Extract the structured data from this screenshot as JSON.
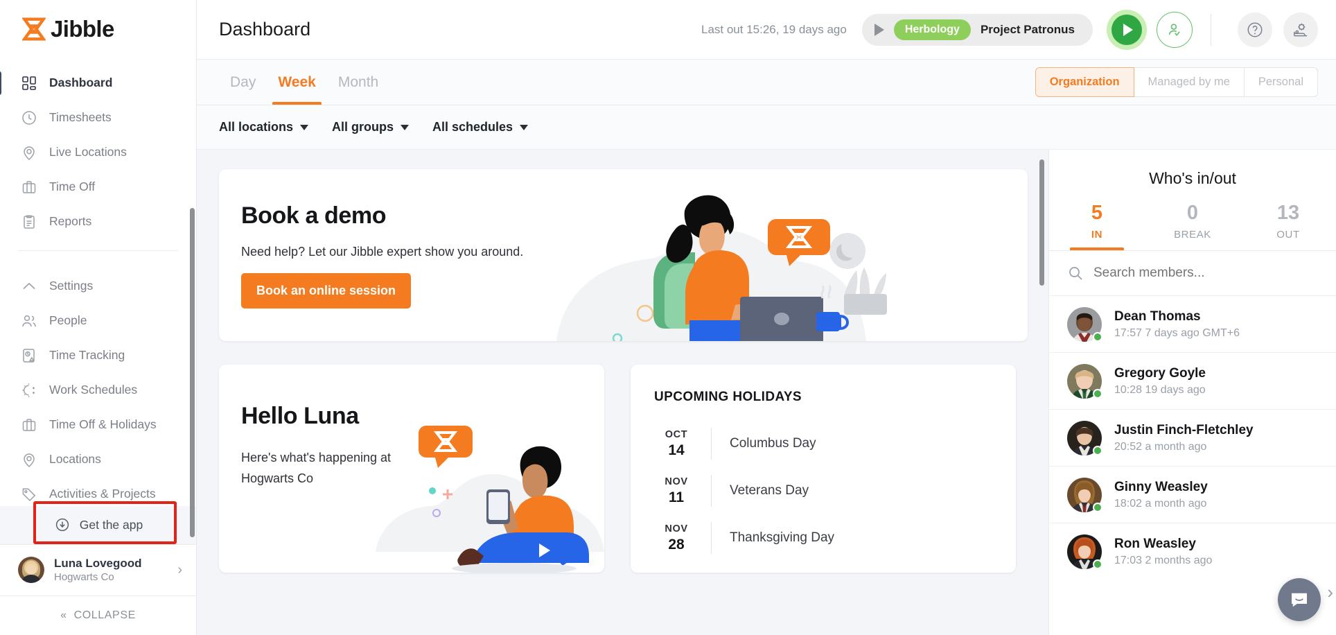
{
  "brand": {
    "name": "Jibble",
    "logo_icon": "hourglass-icon"
  },
  "sidebar": {
    "primary": [
      {
        "label": "Dashboard",
        "icon": "dashboard-grid-icon",
        "active": true
      },
      {
        "label": "Timesheets",
        "icon": "clock-icon",
        "active": false
      },
      {
        "label": "Live Locations",
        "icon": "map-pin-icon",
        "active": false
      },
      {
        "label": "Time Off",
        "icon": "briefcase-icon",
        "active": false
      },
      {
        "label": "Reports",
        "icon": "clipboard-icon",
        "active": false
      }
    ],
    "secondary": [
      {
        "label": "Settings",
        "icon": "chevron-up-icon"
      },
      {
        "label": "People",
        "icon": "people-icon"
      },
      {
        "label": "Time Tracking",
        "icon": "time-tracking-icon"
      },
      {
        "label": "Work Schedules",
        "icon": "sun-moon-icon"
      },
      {
        "label": "Time Off & Holidays",
        "icon": "briefcase-icon"
      },
      {
        "label": "Locations",
        "icon": "map-pin-icon"
      },
      {
        "label": "Activities & Projects",
        "icon": "tag-icon"
      }
    ],
    "get_app": {
      "label": "Get the app",
      "icon": "download-circle-icon"
    },
    "user": {
      "name": "Luna Lovegood",
      "org": "Hogwarts Co",
      "chevron": "chevron-right-icon"
    },
    "collapse": {
      "label": "COLLAPSE",
      "icon": "double-chevron-left-icon"
    }
  },
  "topbar": {
    "title": "Dashboard",
    "last_out": "Last out 15:26, 19 days ago",
    "tracker": {
      "activity": "Herbology",
      "project": "Project Patronus",
      "play_icon": "play-triangle-icon"
    },
    "clock_in_button": "play-button",
    "people_button": "person-check-icon",
    "help_button": "question-mark-icon",
    "settings_button": "gear-bed-icon"
  },
  "tabs": {
    "items": [
      {
        "label": "Day",
        "active": false
      },
      {
        "label": "Week",
        "active": true
      },
      {
        "label": "Month",
        "active": false
      }
    ],
    "scope": [
      {
        "label": "Organization",
        "active": true
      },
      {
        "label": "Managed by me",
        "active": false
      },
      {
        "label": "Personal",
        "active": false
      }
    ]
  },
  "filters": [
    {
      "label": "All locations"
    },
    {
      "label": "All groups"
    },
    {
      "label": "All schedules"
    }
  ],
  "demo_card": {
    "title": "Book a demo",
    "subtitle": "Need help? Let our Jibble expert show you around.",
    "button": "Book an online session",
    "illustration": "woman-at-laptop-illustration"
  },
  "hello_card": {
    "title": "Hello Luna",
    "subtitle": "Here's what's happening at Hogwarts Co",
    "illustration": "person-with-phone-illustration"
  },
  "holidays": {
    "title": "UPCOMING HOLIDAYS",
    "items": [
      {
        "month": "OCT",
        "day": "14",
        "name": "Columbus Day"
      },
      {
        "month": "NOV",
        "day": "11",
        "name": "Veterans Day"
      },
      {
        "month": "NOV",
        "day": "28",
        "name": "Thanksgiving Day"
      }
    ]
  },
  "whos_in_out": {
    "title": "Who's in/out",
    "stats": [
      {
        "count": "5",
        "label": "IN",
        "active": true
      },
      {
        "count": "0",
        "label": "BREAK",
        "active": false
      },
      {
        "count": "13",
        "label": "OUT",
        "active": false
      }
    ],
    "search_placeholder": "Search members...",
    "members": [
      {
        "name": "Dean Thomas",
        "time": "17:57 7 days ago GMT+6",
        "status": "online"
      },
      {
        "name": "Gregory Goyle",
        "time": "10:28 19 days ago",
        "status": "online"
      },
      {
        "name": "Justin Finch-Fletchley",
        "time": "20:52 a month ago",
        "status": "online"
      },
      {
        "name": "Ginny Weasley",
        "time": "18:02 a month ago",
        "status": "online"
      },
      {
        "name": "Ron Weasley",
        "time": "17:03 2 months ago",
        "status": "online"
      }
    ]
  },
  "chat_widget": {
    "icon": "intercom-chat-icon"
  },
  "colors": {
    "accent_orange": "#f47b20",
    "green_chip": "#8ecf5c",
    "play_green": "#2fa844",
    "status_online": "#4caf50",
    "highlight_red": "#e2231a",
    "sidebar_active": "#3d4a63"
  }
}
